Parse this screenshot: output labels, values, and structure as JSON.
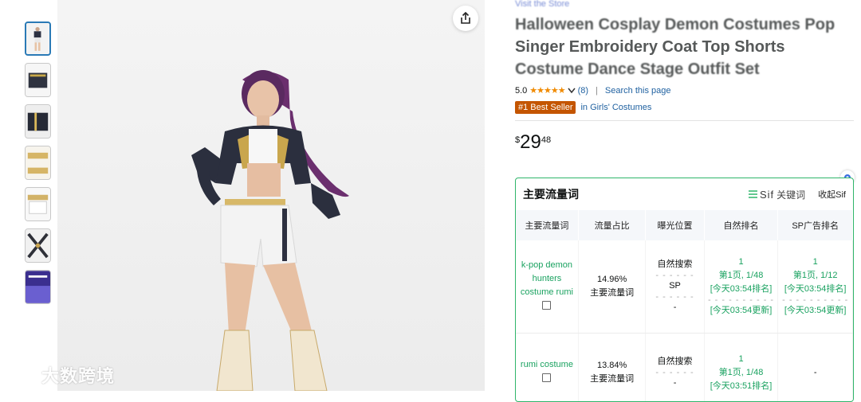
{
  "product": {
    "brand": "Visit the Store",
    "title_blur_1": "Halloween Cosplay Demon Costumes Pop",
    "title_line_2": "Singer Embroidery Coat Top Shorts",
    "title_line_3": "Costume Dance Stage Outfit Set",
    "rating_value": "5.0",
    "stars": "★★★★★",
    "review_count": "(8)",
    "search_link": "Search this page",
    "best_seller_badge": "#1 Best Seller",
    "category_link": "in Girls' Costumes",
    "price_symbol": "$",
    "price_whole": "29",
    "price_fraction": "48"
  },
  "thumbnails": [
    {
      "active": true
    },
    {
      "active": false
    },
    {
      "active": false
    },
    {
      "active": false
    },
    {
      "active": false
    },
    {
      "active": false
    },
    {
      "active": false
    }
  ],
  "watermark": {
    "text": "大数跨境"
  },
  "keyword_panel": {
    "title": "主要流量词",
    "sif_label": "Sif",
    "sif_suffix": "关键词",
    "collapse_label": "收起Sif",
    "columns": [
      "主要流量词",
      "流量占比",
      "曝光位置",
      "自然排名",
      "SP广告排名"
    ],
    "rows": [
      {
        "keyword": "k-pop demon hunters costume rumi",
        "share": "14.96%",
        "share_tag": "主要流量词",
        "exposure_1": "自然搜索",
        "exposure_2": "SP",
        "exposure_3": "-",
        "natural_rank": "1",
        "natural_page": "第1页, 1/48",
        "natural_time": "[今天03:54排名]",
        "natural_update": "[今天03:54更新]",
        "sp_rank": "1",
        "sp_page": "第1页, 1/12",
        "sp_time": "[今天03:54排名]",
        "sp_update": "[今天03:54更新]"
      },
      {
        "keyword": "rumi costume",
        "share": "13.84%",
        "share_tag": "主要流量词",
        "exposure_1": "自然搜索",
        "exposure_2": "-",
        "natural_rank": "1",
        "natural_page": "第1页, 1/48",
        "natural_time": "[今天03:51排名]",
        "sp_rank": "-"
      }
    ]
  },
  "colors": {
    "accent_green": "#1aa260",
    "link_blue": "#2162a1",
    "badge_orange": "#c45500",
    "star_orange": "#f08a00"
  }
}
